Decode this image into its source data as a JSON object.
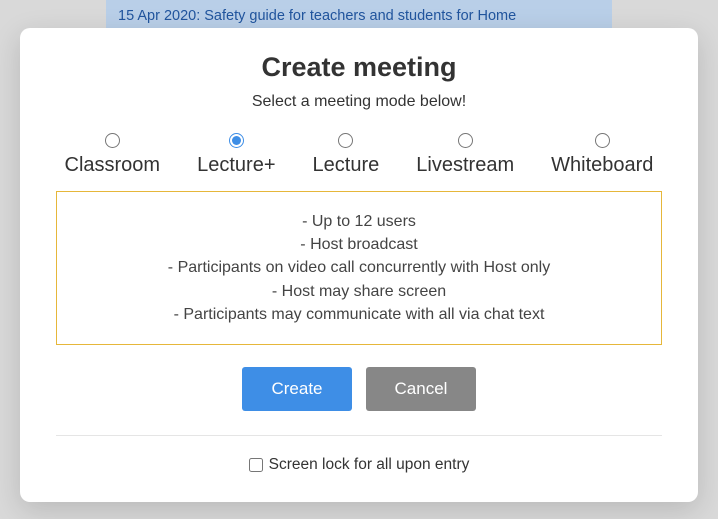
{
  "background_banner": "15 Apr 2020: Safety guide for teachers and students for Home",
  "modal": {
    "title": "Create meeting",
    "subtitle": "Select a meeting mode below!",
    "modes": [
      {
        "label": "Classroom",
        "selected": false
      },
      {
        "label": "Lecture+",
        "selected": true
      },
      {
        "label": "Lecture",
        "selected": false
      },
      {
        "label": "Livestream",
        "selected": false
      },
      {
        "label": "Whiteboard",
        "selected": false
      }
    ],
    "features": [
      "- Up to 12 users",
      "- Host broadcast",
      "- Participants on video call concurrently with Host only",
      "- Host may share screen",
      "- Participants may communicate with all via chat text"
    ],
    "create_label": "Create",
    "cancel_label": "Cancel",
    "screenlock_label": "Screen lock for all upon entry",
    "screenlock_checked": false
  }
}
